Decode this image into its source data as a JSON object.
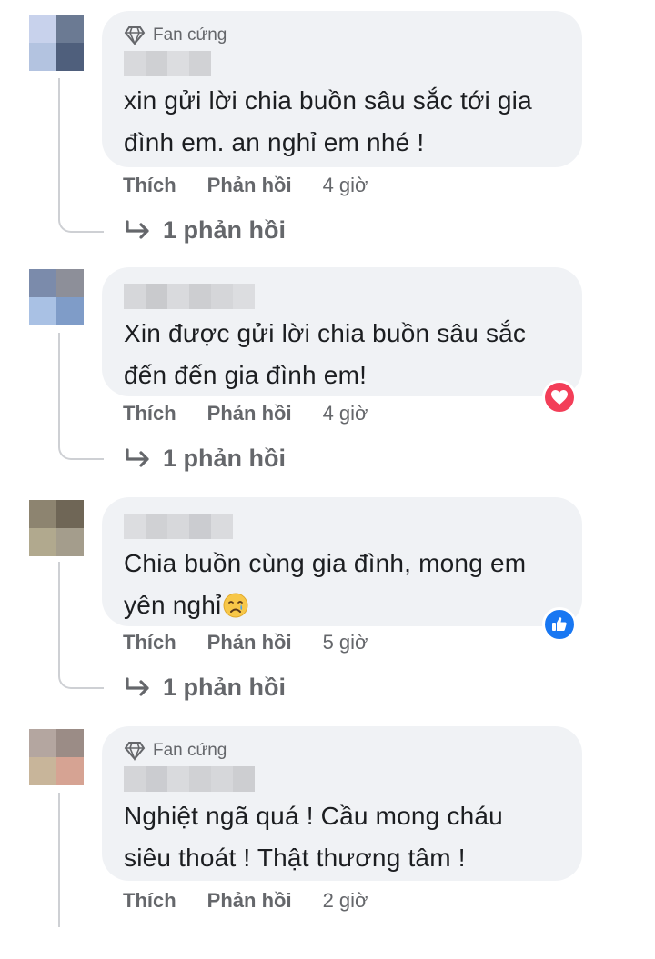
{
  "comments": [
    {
      "badge": "Fan cứng",
      "text_lines": [
        "xin gửi lời chia buồn sâu sắc tới gia",
        "đình em. an nghỉ em nhé !"
      ],
      "like_label": "Thích",
      "reply_label": "Phản hồi",
      "time": "4 giờ",
      "replies_label": "1 phản hồi",
      "reaction": ""
    },
    {
      "badge": "",
      "text_lines": [
        "Xin được gửi lời chia buồn sâu sắc",
        "đến đến gia đình em!"
      ],
      "like_label": "Thích",
      "reply_label": "Phản hồi",
      "time": "4 giờ",
      "replies_label": "1 phản hồi",
      "reaction": "heart"
    },
    {
      "badge": "",
      "text_lines": [
        "Chia buồn cùng gia đình, mong em",
        "yên nghỉ"
      ],
      "like_label": "Thích",
      "reply_label": "Phản hồi",
      "time": "5 giờ",
      "replies_label": "1 phản hồi",
      "reaction": "like"
    },
    {
      "badge": "Fan cứng",
      "text_lines": [
        "Nghiệt ngã quá ! Cầu mong cháu",
        "siêu thoát ! Thật thương tâm !"
      ],
      "like_label": "Thích",
      "reply_label": "Phản hồi",
      "time": "2 giờ",
      "replies_label": "",
      "reaction": ""
    }
  ],
  "icons": {
    "badge": "diamond-icon",
    "reply_arrow": "reply-arrow-icon",
    "heart_reaction": "heart-reaction-icon",
    "like_reaction": "like-reaction-icon",
    "crying_emoji": "crying-face-emoji"
  },
  "colors": {
    "bubble": "#f0f2f5",
    "secondary_text": "#65676b",
    "heart": "#f33e58",
    "like": "#1877f2"
  }
}
